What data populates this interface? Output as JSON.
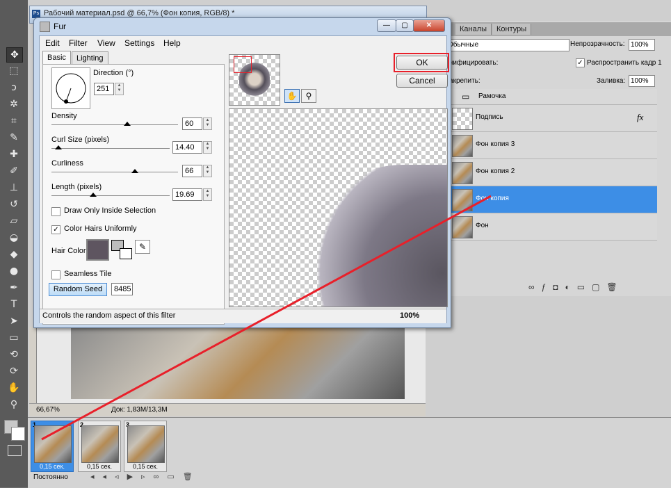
{
  "app": {
    "doc_title": "Рабочий материал.psd @ 66,7% (Фон копия, RGB/8) *",
    "zoom": "66,67%",
    "doc_info": "Док: 1,83M/13,3M"
  },
  "right_panel": {
    "tabs": [
      "Каналы",
      "Контуры"
    ],
    "blend_mode": "Обычные",
    "opacity_label": "Непрозрачность:",
    "opacity_value": "100%",
    "fix_label": "Закрепить:",
    "fill_label": "Заливка:",
    "fill_value": "100%",
    "unify_label": "Унифицировать:",
    "propagate_label": "Распространить кадр 1",
    "layers": [
      {
        "name": "Рамочка",
        "kind": "folder"
      },
      {
        "name": "Подпись",
        "kind": "text",
        "fx": "fx"
      },
      {
        "name": "Фон копия 3",
        "kind": "image"
      },
      {
        "name": "Фон копия 2",
        "kind": "image"
      },
      {
        "name": "Фон копия",
        "kind": "image",
        "selected": true
      },
      {
        "name": "Фон",
        "kind": "image"
      }
    ]
  },
  "animation": {
    "frames": [
      {
        "num": "1",
        "time": "0,15 сек.",
        "selected": true
      },
      {
        "num": "2",
        "time": "0,15 сек."
      },
      {
        "num": "3",
        "time": "0,15 сек."
      }
    ],
    "loop": "Постоянно"
  },
  "fur": {
    "title": "Fur",
    "menu": [
      "Edit",
      "Filter",
      "View",
      "Settings",
      "Help"
    ],
    "tabs": [
      "Basic",
      "Lighting"
    ],
    "direction_label": "Direction (°)",
    "direction_value": "251",
    "density_label": "Density",
    "density_value": "60",
    "density_level": 0.6,
    "curl_label": "Curl Size (pixels)",
    "curl_value": "14.40",
    "curl_level": 0.06,
    "curliness_label": "Curliness",
    "curliness_value": "66",
    "curliness_level": 0.66,
    "length_label": "Length (pixels)",
    "length_value": "19.69",
    "length_level": 0.35,
    "inside_selection_label": "Draw Only Inside Selection",
    "inside_selection_checked": false,
    "uniform_label": "Color Hairs Uniformly",
    "uniform_checked": true,
    "hair_color_label": "Hair Color",
    "hair_color": "#5e5560",
    "seamless_label": "Seamless Tile",
    "seamless_checked": false,
    "random_seed_label": "Random Seed",
    "random_seed_value": "8485",
    "ok_label": "OK",
    "cancel_label": "Cancel",
    "status_text": "Controls the random aspect of this filter",
    "zoom": "100%"
  },
  "colors": {
    "selection_blue": "#3d8ee6",
    "highlight_red": "#e8202a"
  },
  "icons": [
    "move-tool-icon",
    "hand-icon",
    "zoom-icon",
    "eyedropper-icon",
    "trash-icon",
    "fx-icon",
    "folder-icon"
  ]
}
